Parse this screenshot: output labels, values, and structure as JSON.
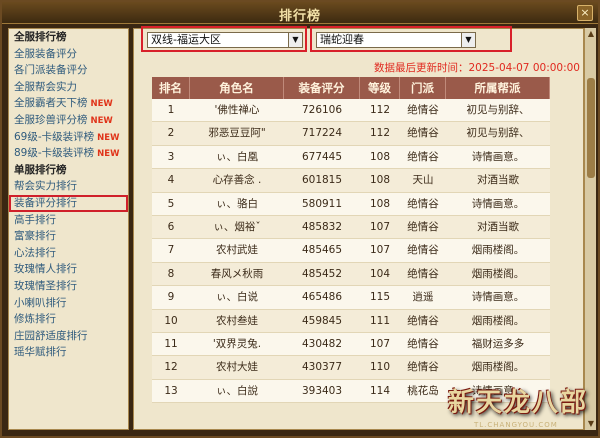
{
  "window": {
    "title": "排行榜",
    "close_label": "×"
  },
  "sidebar": {
    "items": [
      {
        "label": "全服排行榜",
        "type": "header"
      },
      {
        "label": "全服装备评分",
        "type": "item"
      },
      {
        "label": "各门派装备评分",
        "type": "item"
      },
      {
        "label": "全服帮会实力",
        "type": "item"
      },
      {
        "label": "全服霸者天下榜",
        "type": "item",
        "badge": "NEW"
      },
      {
        "label": "全服珍兽评分榜",
        "type": "item",
        "badge": "NEW"
      },
      {
        "label": "69级-卡级装评榜",
        "type": "item",
        "badge": "NEW"
      },
      {
        "label": "89级-卡级装评榜",
        "type": "item",
        "badge": "NEW"
      },
      {
        "label": "单服排行榜",
        "type": "header"
      },
      {
        "label": "帮会实力排行",
        "type": "item"
      },
      {
        "label": "装备评分排行",
        "type": "item",
        "active": true
      },
      {
        "label": "高手排行",
        "type": "item"
      },
      {
        "label": "富豪排行",
        "type": "item"
      },
      {
        "label": "心法排行",
        "type": "item"
      },
      {
        "label": "玫瑰情人排行",
        "type": "item"
      },
      {
        "label": "玫瑰情圣排行",
        "type": "item"
      },
      {
        "label": "小喇叭排行",
        "type": "item"
      },
      {
        "label": "修炼排行",
        "type": "item"
      },
      {
        "label": "庄园舒适度排行",
        "type": "item"
      },
      {
        "label": "瑶华赋排行",
        "type": "item"
      }
    ]
  },
  "filters": {
    "server_group": "双线-福运大区",
    "server": "瑞蛇迎春",
    "arrow": "▼"
  },
  "updated_text": "数据最后更新时间：2025-04-07 00:00:00",
  "table": {
    "headers": [
      "排名",
      "角色名",
      "装备评分",
      "等级",
      "门派",
      "所属帮派"
    ],
    "rows": [
      [
        "1",
        "'佛性禅心",
        "726106",
        "112",
        "绝情谷",
        "初见与别辞、"
      ],
      [
        "2",
        "邪恶豆豆阿\"",
        "717224",
        "112",
        "绝情谷",
        "初见与别辞、"
      ],
      [
        "3",
        "ぃ、白凰",
        "677445",
        "108",
        "绝情谷",
        "诗情画意。"
      ],
      [
        "4",
        "心存善念 .",
        "601815",
        "108",
        "天山",
        "对酒当歌"
      ],
      [
        "5",
        "ぃ、骆白",
        "580911",
        "108",
        "绝情谷",
        "诗情画意。"
      ],
      [
        "6",
        "ぃ、烟裕ˇ",
        "485832",
        "107",
        "绝情谷",
        "对酒当歌"
      ],
      [
        "7",
        "农村武娃",
        "485465",
        "107",
        "绝情谷",
        "烟雨楼阁。"
      ],
      [
        "8",
        "春风メ秋雨",
        "485452",
        "104",
        "绝情谷",
        "烟雨楼阁。"
      ],
      [
        "9",
        "ぃ、白说",
        "465486",
        "115",
        "逍遥",
        "诗情画意。"
      ],
      [
        "10",
        "农村叁娃",
        "459845",
        "111",
        "绝情谷",
        "烟雨楼阁。"
      ],
      [
        "11",
        "'双界灵兔.",
        "430482",
        "107",
        "绝情谷",
        "福财运多多"
      ],
      [
        "12",
        "农村大娃",
        "430377",
        "110",
        "绝情谷",
        "烟雨楼阁。"
      ],
      [
        "13",
        "ぃ、白說",
        "393403",
        "114",
        "桃花岛",
        "诗情画意。"
      ]
    ]
  },
  "logo": {
    "text": "新天龙八部",
    "sub": "TL.CHANGYOU.COM"
  },
  "scrollbar": {
    "up": "▲",
    "down": "▼"
  }
}
